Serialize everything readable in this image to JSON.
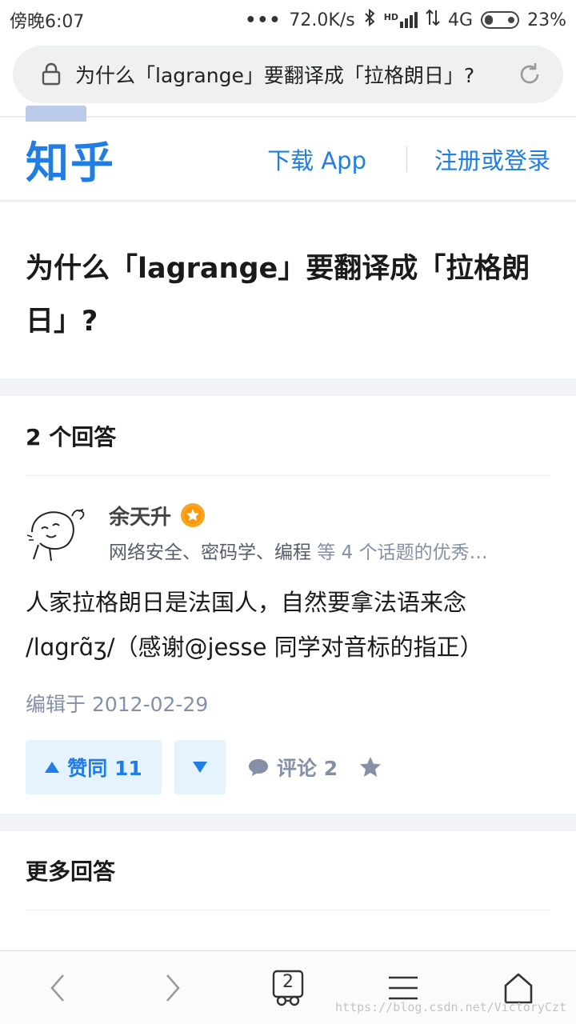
{
  "status_bar": {
    "time": "傍晚6:07",
    "dots": "•••",
    "speed": "72.0K/s",
    "bluetooth_icon": "bluetooth-icon",
    "signal_hd": "HD",
    "network": "4G",
    "battery": "23%",
    "battery_level": 0.23
  },
  "browser": {
    "url_text": "为什么「lagrange」要翻译成「拉格朗日」?",
    "lock_icon": "lock-icon",
    "reload_icon": "reload-icon"
  },
  "header": {
    "logo": "知乎",
    "download": "下载 App",
    "login": "注册或登录"
  },
  "question": {
    "title": "为什么「lagrange」要翻译成「拉格朗日」?"
  },
  "answers": {
    "count_label": "2 个回答",
    "items": [
      {
        "author": "余天升",
        "bio_topics": "网络安全、密码学、编程",
        "bio_more": " 等 4 个话题的优秀…",
        "content": "人家拉格朗日是法国人，自然要拿法语来念 /lɑgrɑ̃ʒ/（感谢@jesse 同学对音标的指正）",
        "edit_time": "编辑于 2012-02-29",
        "vote_label": "赞同 11",
        "comment_label": "评论 2"
      }
    ]
  },
  "more_answers": {
    "title": "更多回答"
  },
  "bottom_nav": {
    "tab_count": "2"
  },
  "watermark": "https://blog.csdn.net/VictoryCzt",
  "colors": {
    "brand": "#1f7de3",
    "muted": "#8590a6",
    "vote_bg": "#e5f2ff"
  }
}
